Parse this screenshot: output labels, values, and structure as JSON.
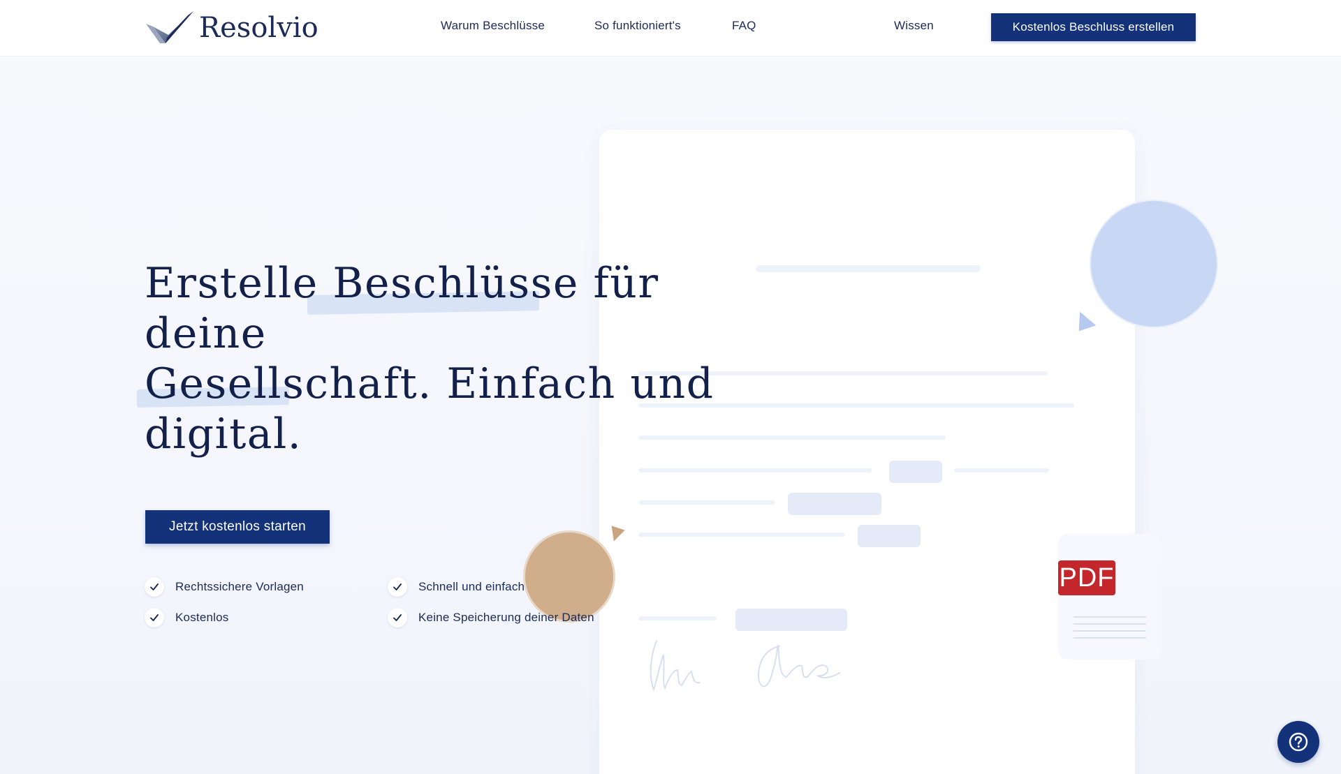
{
  "header": {
    "brand": "Resolvio",
    "nav": [
      "Warum Beschlüsse",
      "So funktioniert's",
      "FAQ",
      "Wissen"
    ],
    "cta_label": "Kostenlos Beschluss erstellen"
  },
  "hero": {
    "headline": {
      "line1": "Erstelle Beschlüsse für deine",
      "line2": "Gesellschaft. Einfach und",
      "line3": "digital."
    },
    "cta_label": "Jetzt kostenlos starten",
    "features": [
      "Rechtssichere Vorlagen",
      "Schnell und einfach",
      "Kostenlos",
      "Keine Speicherung deiner Daten"
    ]
  },
  "illustration": {
    "pdf_label": "PDF"
  },
  "colors": {
    "primary": "#13327a",
    "text": "#13204a",
    "accent_blue": "#c8d7f4",
    "accent_gold": "#d0ae8b",
    "pdf_red": "#c3272c"
  },
  "icons": {
    "logo": "checkmark-logo-icon",
    "feature": "check-icon",
    "help": "question-icon"
  }
}
